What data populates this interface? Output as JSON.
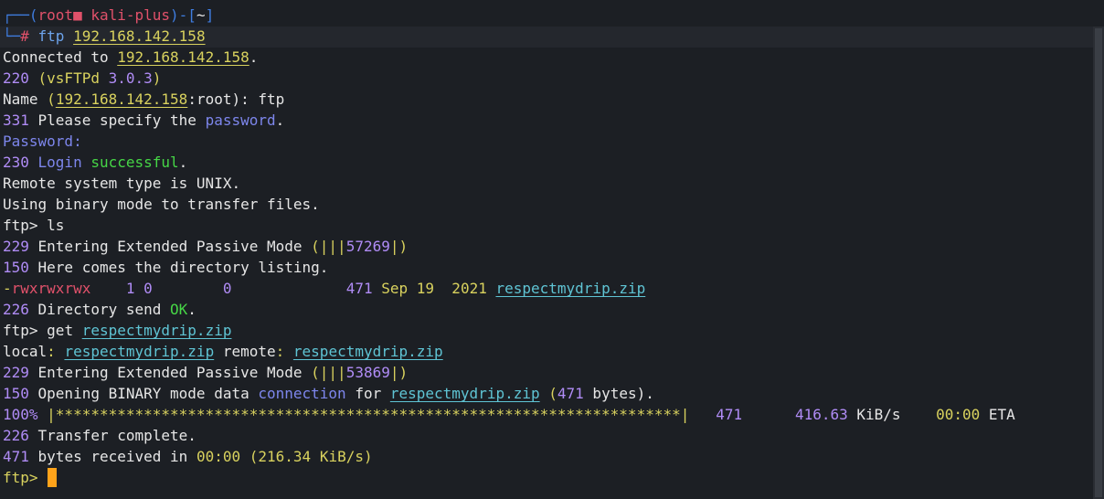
{
  "prompt": {
    "corner_top": "┌──(",
    "user": "root",
    "skull": "■",
    "host": " kali-plus",
    "mid": ")-[",
    "cwd": "~",
    "end": "]",
    "corner_bottom": "└─",
    "hash": "# ",
    "command": "ftp",
    "arg": "192.168.142.158"
  },
  "output": {
    "connected_prefix": "Connected to ",
    "connected_ip": "192.168.142.158",
    "connected_dot": ".",
    "banner_code": "220 ",
    "banner_open": "(vsFTPd ",
    "banner_ver": "3.0.3",
    "banner_close": ")",
    "name_label": "Name ",
    "name_open": "(",
    "name_ip": "192.168.142.158",
    "name_rest": ":root): ",
    "name_value": "ftp",
    "pw_code": "331 ",
    "pw_text1": "Please specify the ",
    "pw_word": "password",
    "pw_dot": ".",
    "password_prompt": "Password:",
    "login_code": "230 ",
    "login_word": "Login ",
    "login_success": "successful",
    "login_dot": ".",
    "remote": "Remote system type is UNIX.",
    "binary": "Using binary mode to transfer files.",
    "ftp_prompt": "ftp> ",
    "cmd_ls": "ls",
    "pasv1_code": "229 ",
    "pasv1_text": "Entering Extended Passive Mode ",
    "pasv1_open": "(|||",
    "pasv1_port": "57269",
    "pasv1_close": "|)",
    "list_code": "150 ",
    "list_text": "Here comes the directory listing.",
    "perm_dash": "-",
    "perm_bits": "rwxrwxrwx",
    "ls_links": "    1 0        0             ",
    "ls_size": "471",
    "ls_date": " Sep 19  2021 ",
    "ls_file": "respectmydrip.zip",
    "dir_code": "226 ",
    "dir_text": "Directory send ",
    "dir_ok": "OK",
    "dir_dot": ".",
    "cmd_get": "get ",
    "get_file": "respectmydrip.zip",
    "local_label": "local",
    "local_colon": ": ",
    "local_file": "respectmydrip.zip",
    "remote_label": " remote",
    "remote_colon": ": ",
    "remote_file": "respectmydrip.zip",
    "pasv2_code": "229 ",
    "pasv2_text": "Entering Extended Passive Mode ",
    "pasv2_open": "(|||",
    "pasv2_port": "53869",
    "pasv2_close": "|)",
    "open_code": "150 ",
    "open_text": "Opening BINARY mode data ",
    "open_conn": "connection",
    "open_for": " for ",
    "open_file": "respectmydrip.zip",
    "open_paren": " (",
    "open_size": "471",
    "open_bytes": " bytes).",
    "prog_pct": "100%",
    "prog_bar": " |***********************************************************************|",
    "prog_size": "   471",
    "prog_rate": "      416.63",
    "prog_unit": " KiB/s",
    "prog_time": "    00:00",
    "prog_eta": " ETA",
    "done_code": "226 ",
    "done_text": "Transfer complete.",
    "recv_count": "471",
    "recv_text": " bytes received in ",
    "recv_time": "00:00",
    "recv_rate": " (216.34 ",
    "recv_unit": "KiB/s)",
    "final_prompt": "ftp>"
  },
  "colors": {
    "background": "#1c1f24",
    "cursor": "#ffa31a"
  }
}
